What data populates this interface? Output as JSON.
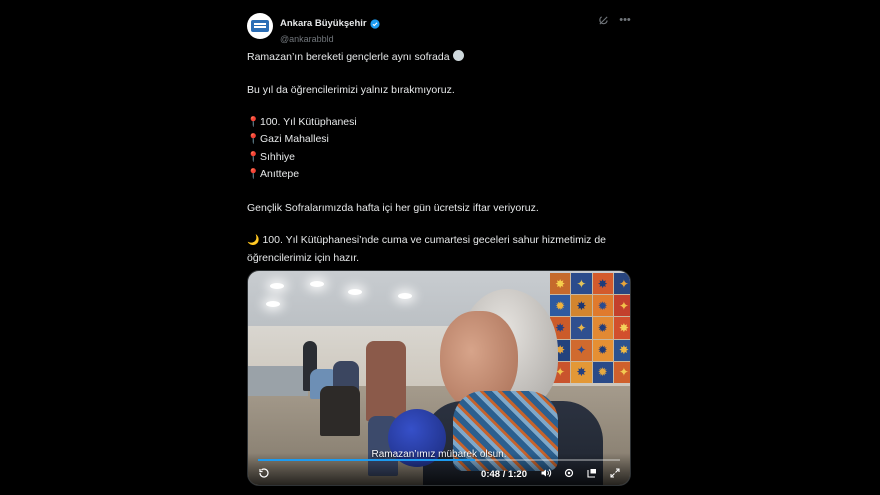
{
  "account": {
    "display_name": "Ankara Büyükşehir",
    "handle": "@ankarabbld",
    "verified_color": "#1d9bf0"
  },
  "icons": {
    "grok": "grok-icon",
    "more": "more-icon",
    "pin": "📍",
    "moon": "🌙"
  },
  "tweet": {
    "line1": "Ramazan’ın bereketi gençlerle aynı sofrada",
    "line2": "Bu yıl da öğrencilerimizi yalnız bırakmıyoruz.",
    "locations": [
      "100. Yıl Kütüphanesi",
      "Gazi Mahallesi",
      "Sıhhiye",
      "Anıttepe"
    ],
    "line3": "Gençlik Sofralarımızda hafta içi her gün ücretsiz iftar veriyoruz.",
    "line4": "100. Yıl Kütüphanesi’nde cuma ve cumartesi geceleri sahur hizmetimiz de öğrencilerimiz için hazır."
  },
  "video": {
    "caption": "Ramazan’ımız mübarek olsun.",
    "current_time": "0:48",
    "duration": "1:20",
    "time_display": "0:48 / 1:20",
    "progress_fraction": 0.6,
    "accent": "#1d9bf0"
  }
}
